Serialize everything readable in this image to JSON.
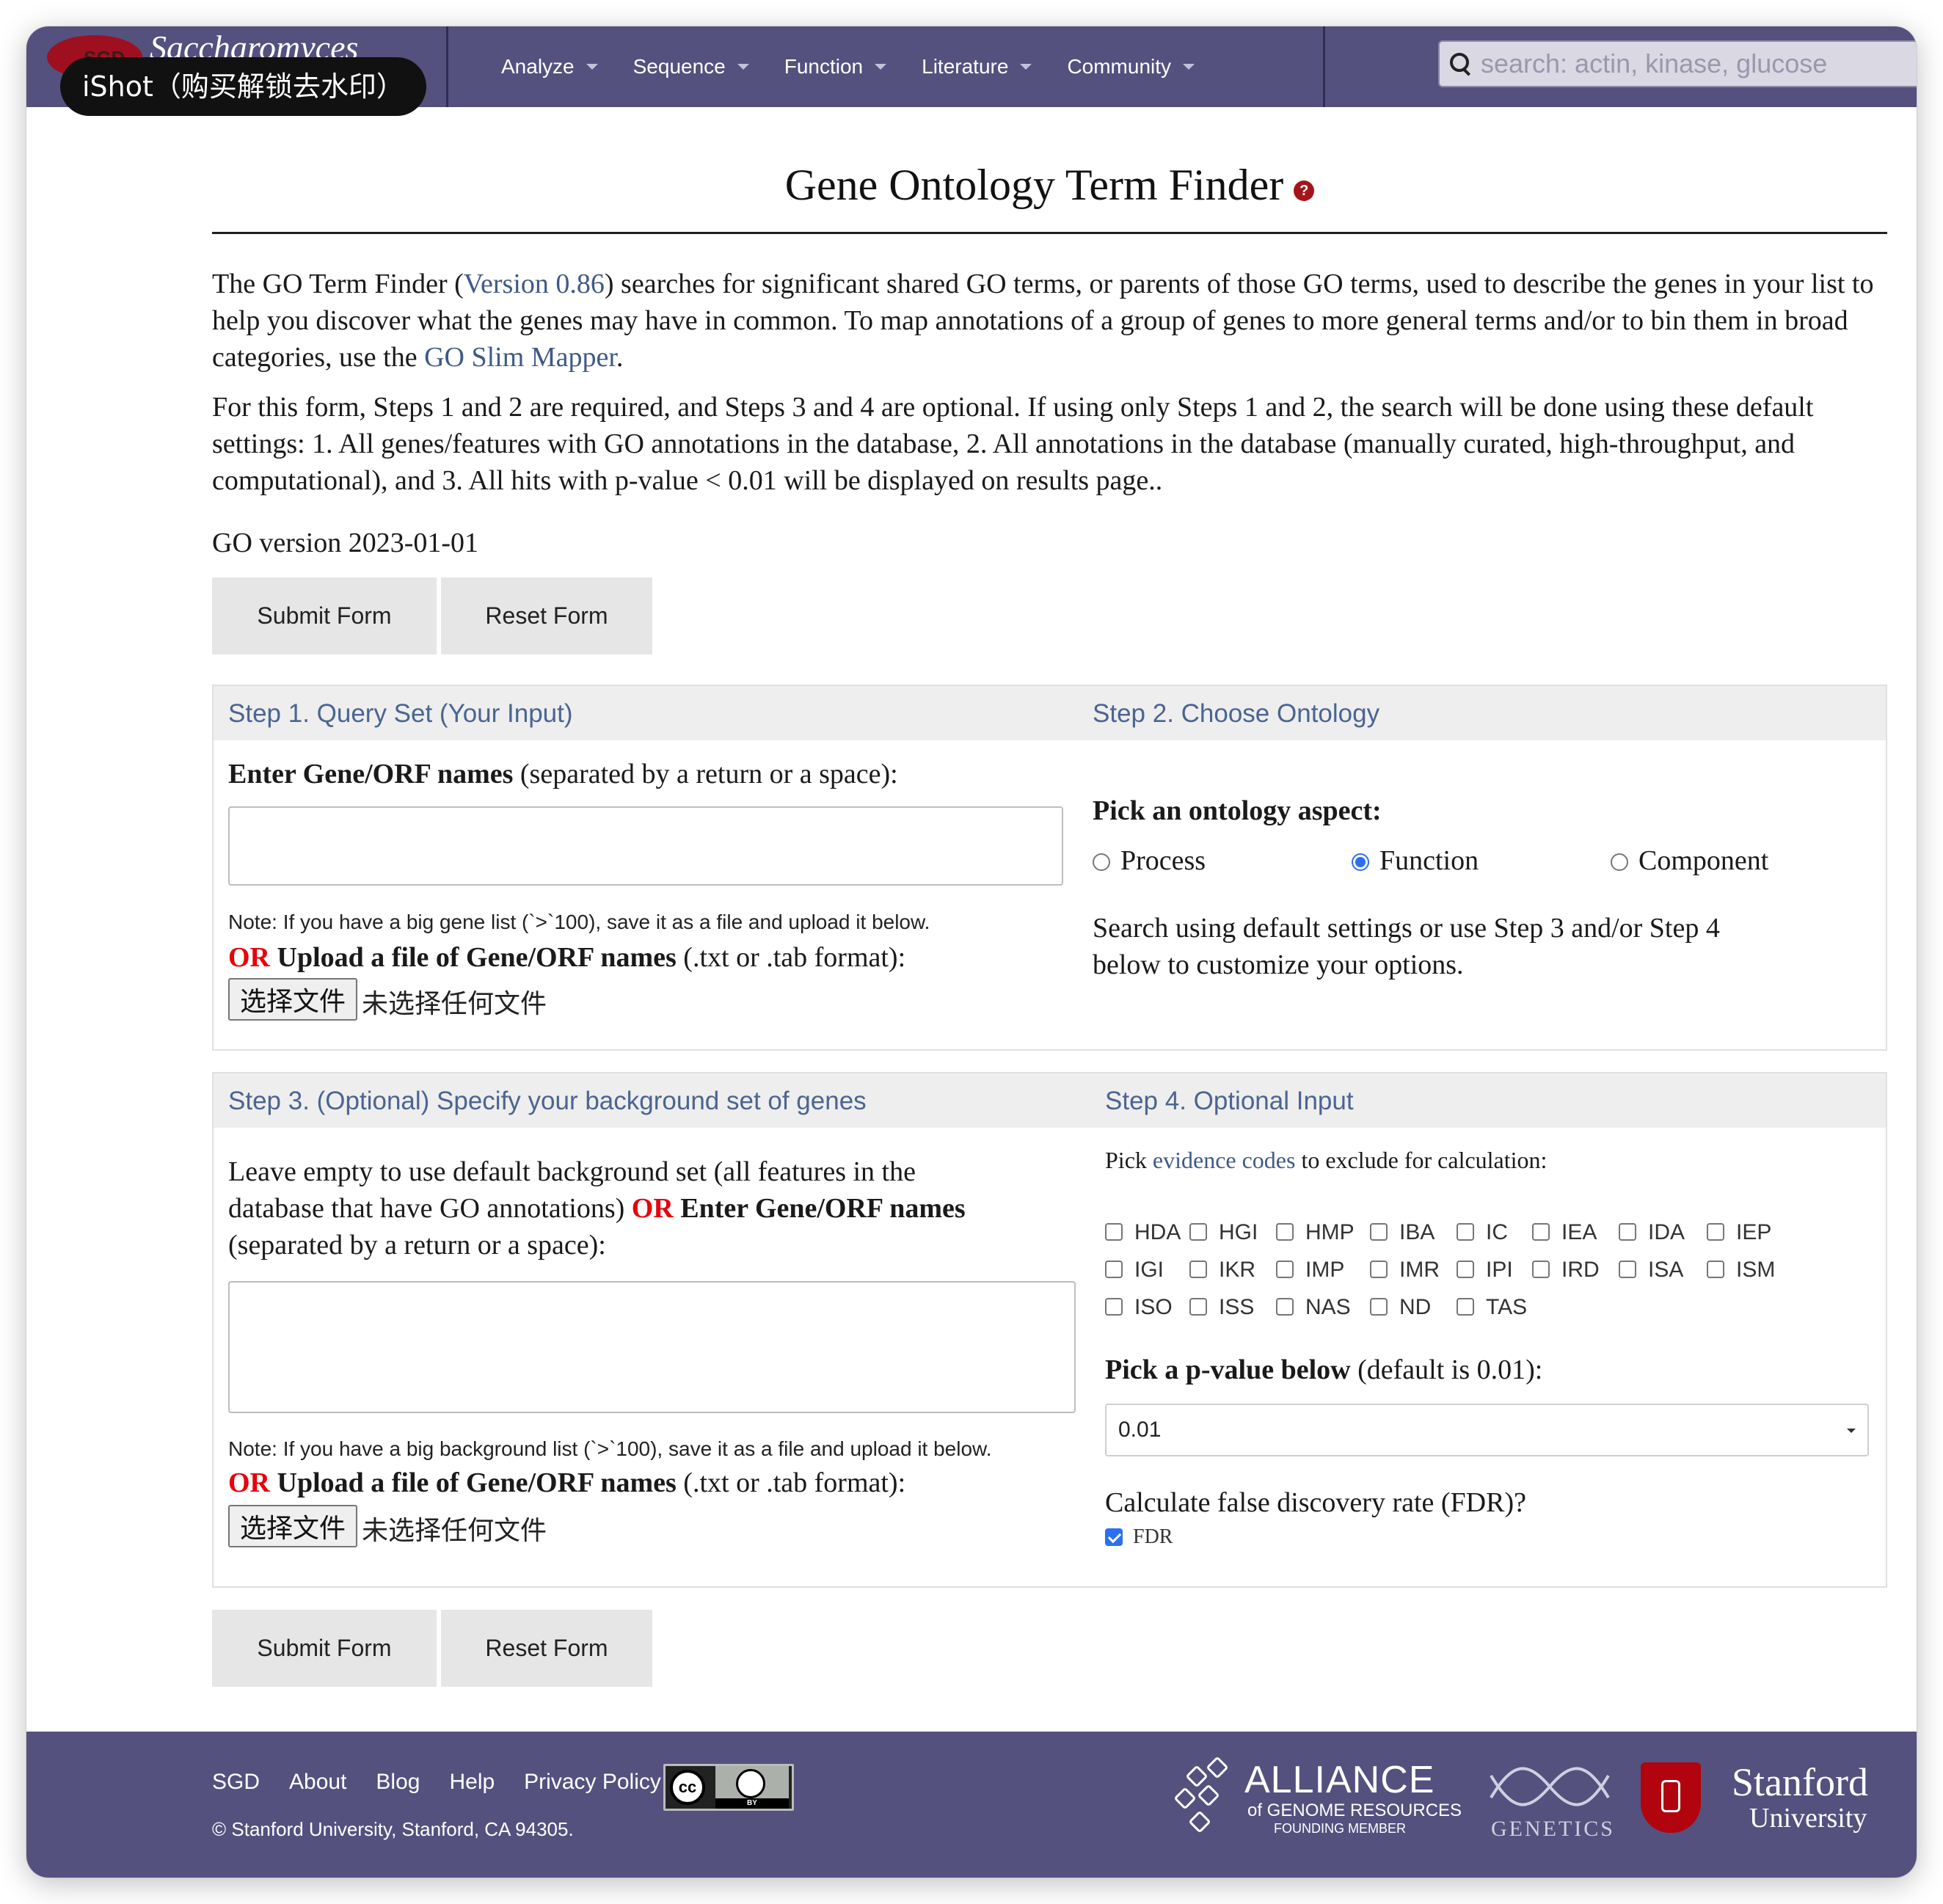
{
  "header": {
    "brand_logo_text": "SGD",
    "brand_name": "Saccharomyces",
    "watermark": "iShot（购买解锁去水印）",
    "nav": [
      "Analyze",
      "Sequence",
      "Function",
      "Literature",
      "Community"
    ],
    "search_placeholder": "search: actin, kinase, glucose"
  },
  "page": {
    "title": "Gene Ontology Term Finder",
    "help_icon": "?",
    "intro": {
      "p1_a": "The GO Term Finder (",
      "version_link": "Version 0.86",
      "p1_b": ") searches for significant shared GO terms, or parents of those GO terms, used to describe the genes in your list to help you discover what the genes may have in common. To map annotations of a group of genes to more general terms and/or to bin them in broad categories, use the ",
      "slim_link": "GO Slim Mapper",
      "p1_c": ".",
      "p2": "For this form, Steps 1 and 2 are required, and Steps 3 and 4 are optional. If using only Steps 1 and 2, the search will be done using these default settings: 1. All genes/features with GO annotations in the database, 2. All annotations in the database (manually curated, high-throughput, and computational), and 3. All hits with p-value < 0.01 will be displayed on results page.."
    },
    "go_version": "GO version 2023-01-01",
    "submit_label": "Submit Form",
    "reset_label": "Reset Form"
  },
  "step1": {
    "heading": "Step 1. Query Set (Your Input)",
    "enter_bold": "Enter Gene/ORF names",
    "enter_rest": " (separated by a return or a space):",
    "note": "Note: If you have a big gene list (`>`100), save it as a file and upload it below.",
    "or": "OR",
    "upload_bold": " Upload a file of Gene/ORF names",
    "upload_rest": " (.txt or .tab format):",
    "file_button": "选择文件",
    "file_none": "未选择任何文件"
  },
  "step2": {
    "heading": "Step 2. Choose Ontology",
    "pick": "Pick an ontology aspect:",
    "options": [
      "Process",
      "Function",
      "Component"
    ],
    "selected": "Function",
    "line1": "Search using default settings or use Step 3 and/or Step 4",
    "line2": "below to customize your options."
  },
  "step3": {
    "heading": "Step 3. (Optional) Specify your background set of genes",
    "line1": "Leave empty to use default background set (all features in the",
    "line2_a": "database that have GO annotations) ",
    "or": "OR",
    "line2_b": " Enter Gene/ORF names",
    "line3": "(separated by a return or a space):",
    "note": "Note: If you have a big background list (`>`100), save it as a file and upload it below.",
    "upload_bold": " Upload a file of Gene/ORF names",
    "upload_rest": " (.txt or .tab format):",
    "file_button": "选择文件",
    "file_none": "未选择任何文件"
  },
  "step4": {
    "heading": "Step 4. Optional Input",
    "pick_a": "Pick ",
    "evidence_link": "evidence codes",
    "pick_b": " to exclude for calculation:",
    "codes_row1": [
      "HDA",
      "HGI",
      "HMP",
      "IBA",
      "IC",
      "IEA",
      "IDA",
      "IEP"
    ],
    "codes_row2": [
      "IGI",
      "IKR",
      "IMP",
      "IMR",
      "IPI",
      "IRD",
      "ISA",
      "ISM"
    ],
    "codes_row3": [
      "ISO",
      "ISS",
      "NAS",
      "ND",
      "TAS"
    ],
    "pvalue_bold": "Pick a p-value below",
    "pvalue_rest": " (default is 0.01):",
    "pvalue_selected": "0.01",
    "fdr_question": "Calculate false discovery rate (FDR)?",
    "fdr_label": "FDR",
    "fdr_checked": true
  },
  "footer": {
    "links": [
      "SGD",
      "About",
      "Blog",
      "Help",
      "Privacy Policy"
    ],
    "cc": "cc",
    "cc_by": "BY",
    "copyright": "© Stanford University, Stanford, CA 94305.",
    "alliance": "ALLIANCE",
    "alliance_sub": "of GENOME RESOURCES",
    "alliance_sub2": "FOUNDING MEMBER",
    "genetics": "GENETICS",
    "stanford": "Stanford",
    "university": "University"
  }
}
